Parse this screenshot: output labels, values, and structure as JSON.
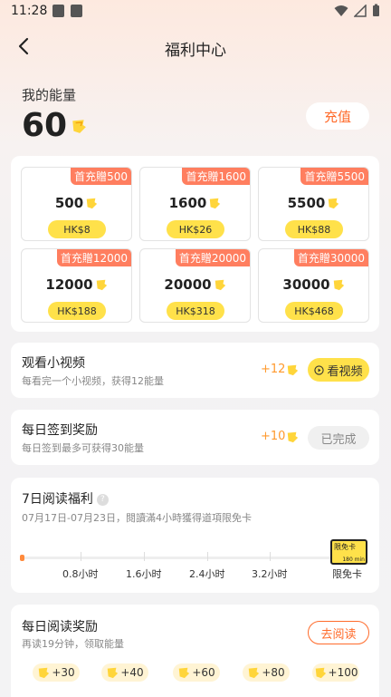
{
  "status_bar": {
    "time": "11:28"
  },
  "header": {
    "title": "福利中心"
  },
  "energy": {
    "label": "我的能量",
    "value": "60",
    "recharge_label": "充值"
  },
  "packs": [
    {
      "badge": "首充贈500",
      "amount": "500",
      "price": "HK$8"
    },
    {
      "badge": "首充贈1600",
      "amount": "1600",
      "price": "HK$26"
    },
    {
      "badge": "首充贈5500",
      "amount": "5500",
      "price": "HK$88"
    },
    {
      "badge": "首充贈12000",
      "amount": "12000",
      "price": "HK$188"
    },
    {
      "badge": "首充贈20000",
      "amount": "20000",
      "price": "HK$318"
    },
    {
      "badge": "首充贈30000",
      "amount": "30000",
      "price": "HK$468"
    }
  ],
  "watch_video": {
    "title": "观看小视频",
    "desc": "每看完一个小视频，获得12能量",
    "reward": "+12",
    "button": "看视频"
  },
  "daily_checkin": {
    "title": "每日签到奖励",
    "desc": "每日签到最多可获得30能量",
    "reward": "+10",
    "button": "已完成"
  },
  "seven_day": {
    "title": "7日阅读福利",
    "help": "?",
    "desc": "07月17日-07月23日，閱讀滿4小時獲得道項限免卡",
    "progress": 0.0,
    "milestones": [
      "0.8小时",
      "1.6小时",
      "2.4小时",
      "3.2小时",
      "限免卡"
    ],
    "card_label": "限免卡",
    "card_sub": "180 min"
  },
  "daily_reading": {
    "title": "每日阅读奖励",
    "desc": "再读19分钟，领取能量",
    "button": "去阅读",
    "rewards": [
      "+30",
      "+40",
      "+60",
      "+80",
      "+100"
    ]
  },
  "colors": {
    "accent": "#ff6b2b",
    "badge": "#ff7e5f",
    "price_bg": "#ffe14a",
    "reward": "#ff9a2e"
  }
}
